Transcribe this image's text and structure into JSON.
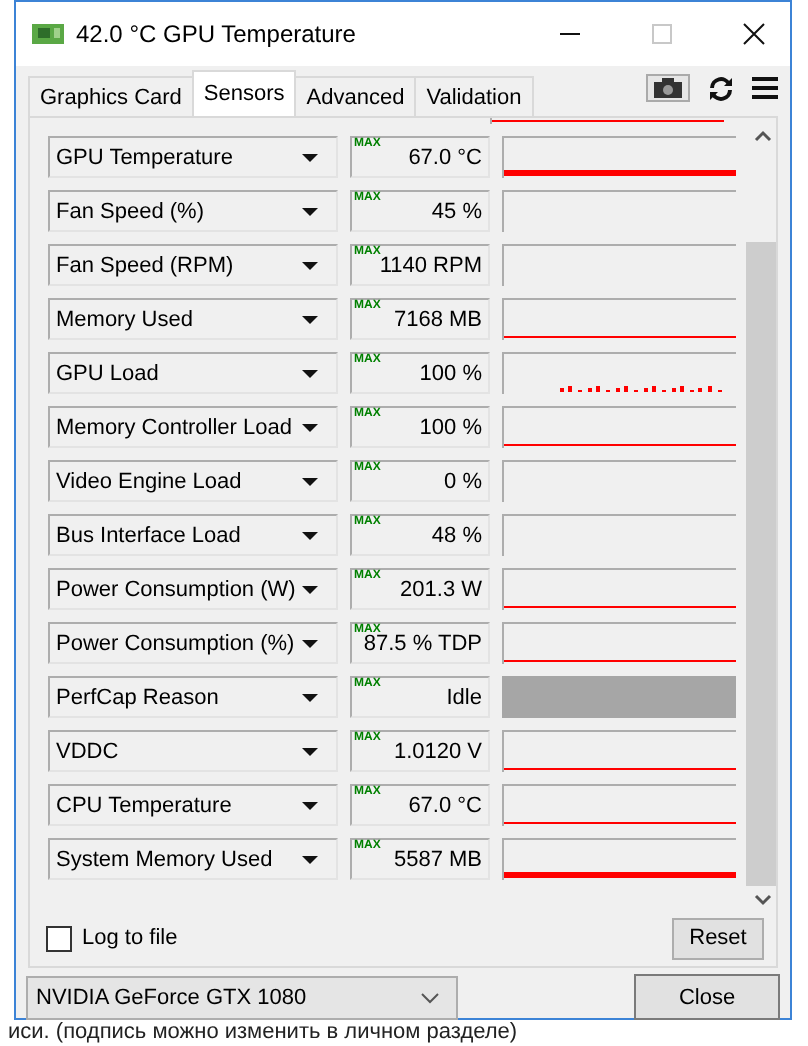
{
  "window": {
    "title": "42.0 °C GPU Temperature",
    "maximize_disabled": true
  },
  "tabs": [
    {
      "label": "Graphics Card",
      "selected": false
    },
    {
      "label": "Sensors",
      "selected": true
    },
    {
      "label": "Advanced",
      "selected": false
    },
    {
      "label": "Validation",
      "selected": false
    }
  ],
  "sensors": [
    {
      "name": "GPU Temperature",
      "max": "MAX",
      "value": "67.0 °C",
      "kind": "thick"
    },
    {
      "name": "Fan Speed (%)",
      "max": "MAX",
      "value": "45 %",
      "kind": "none"
    },
    {
      "name": "Fan Speed (RPM)",
      "max": "MAX",
      "value": "1140 RPM",
      "kind": "none"
    },
    {
      "name": "Memory Used",
      "max": "MAX",
      "value": "7168 MB",
      "kind": "line"
    },
    {
      "name": "GPU Load",
      "max": "MAX",
      "value": "100 %",
      "kind": "spiky"
    },
    {
      "name": "Memory Controller Load",
      "max": "MAX",
      "value": "100 %",
      "kind": "line"
    },
    {
      "name": "Video Engine Load",
      "max": "MAX",
      "value": "0 %",
      "kind": "none"
    },
    {
      "name": "Bus Interface Load",
      "max": "MAX",
      "value": "48 %",
      "kind": "none"
    },
    {
      "name": "Power Consumption (W)",
      "max": "MAX",
      "value": "201.3 W",
      "kind": "line"
    },
    {
      "name": "Power Consumption (%)",
      "max": "MAX",
      "value": "87.5 % TDP",
      "kind": "line"
    },
    {
      "name": "PerfCap Reason",
      "max": "MAX",
      "value": "Idle",
      "kind": "gray"
    },
    {
      "name": "VDDC",
      "max": "MAX",
      "value": "1.0120 V",
      "kind": "line"
    },
    {
      "name": "CPU Temperature",
      "max": "MAX",
      "value": "67.0 °C",
      "kind": "line"
    },
    {
      "name": "System Memory Used",
      "max": "MAX",
      "value": "5587 MB",
      "kind": "thick"
    }
  ],
  "log_to_file": {
    "label": "Log to file",
    "checked": false
  },
  "reset_button": "Reset",
  "gpu_select": {
    "value": "NVIDIA GeForce GTX 1080"
  },
  "close_button": "Close",
  "background_text": "иси. (подпись можно изменить в личном разделе)"
}
